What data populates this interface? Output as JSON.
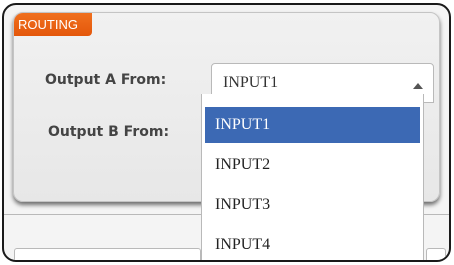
{
  "routing": {
    "section_title": "ROUTING",
    "output_a": {
      "label": "Output A From:",
      "selected_value": "INPUT1"
    },
    "output_b": {
      "label": "Output B From:"
    }
  },
  "dropdown": {
    "options": [
      "INPUT1",
      "INPUT2",
      "INPUT3",
      "INPUT4"
    ],
    "highlighted_index": 0
  },
  "colors": {
    "accent_orange": "#e4570b",
    "highlight_blue": "#3c69b4"
  }
}
